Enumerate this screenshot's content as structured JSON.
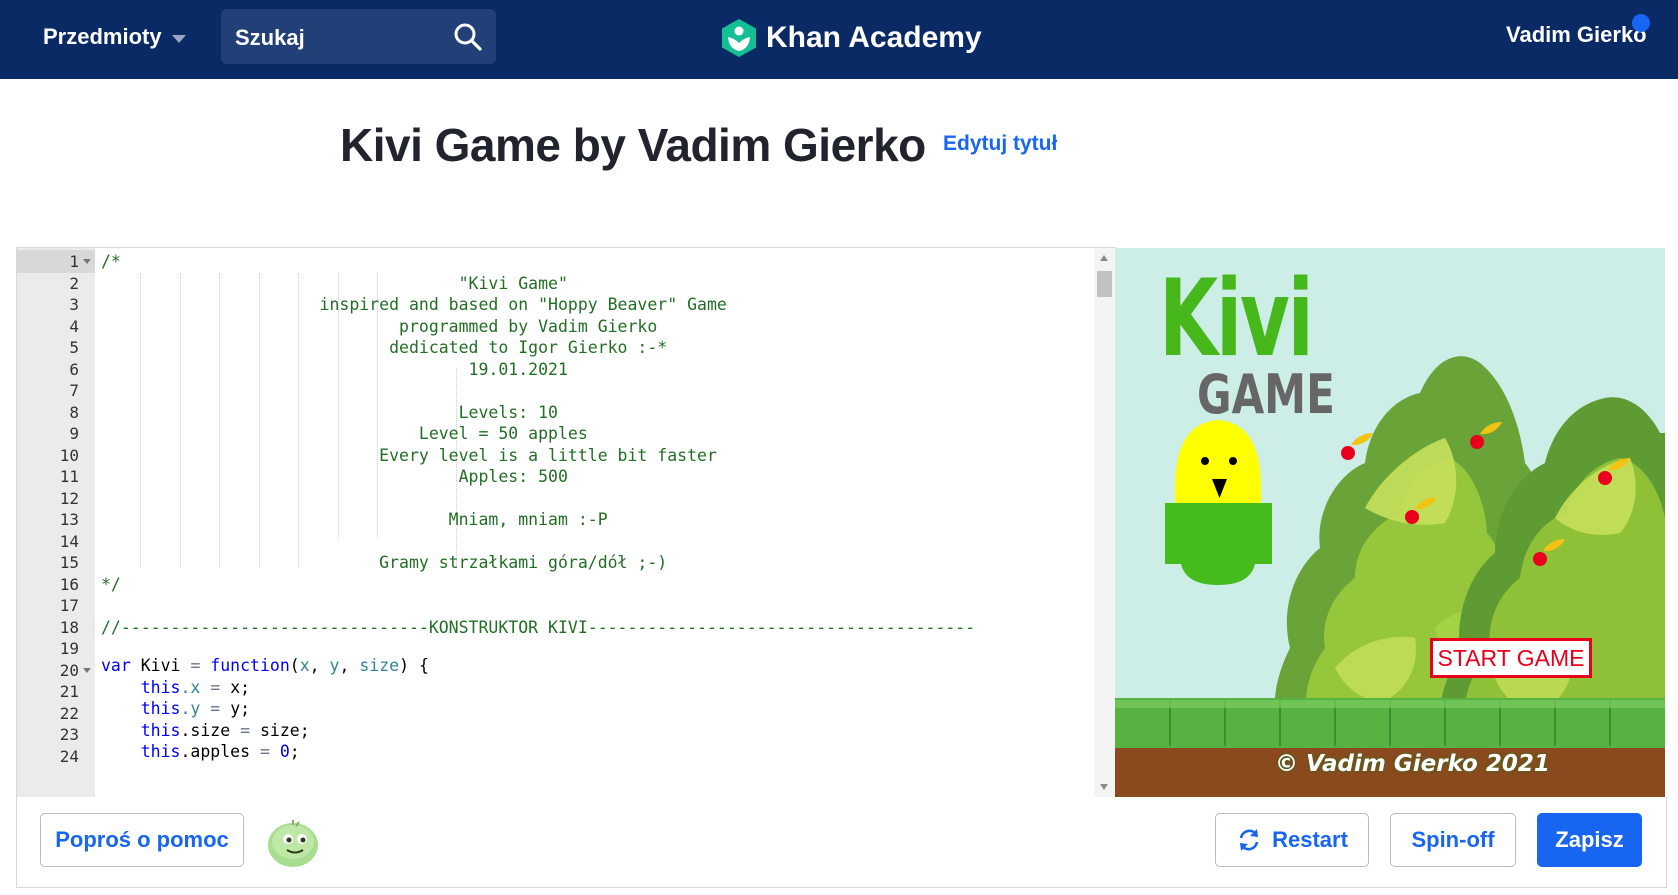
{
  "nav": {
    "subjects_label": "Przedmioty",
    "search_label": "Szukaj",
    "brand_name": "Khan Academy",
    "user_name": "Vadim Gierko",
    "icons": [
      "chevron-down-icon",
      "search-icon",
      "khan-academy-logo-icon",
      "notification-dot-icon"
    ],
    "colors": {
      "nav_bg": "#0a2a66",
      "search_bg": "#223f78",
      "logo_green": "#14bf96",
      "notif": "#1865f2"
    }
  },
  "page": {
    "title": "Kivi Game by Vadim Gierko",
    "edit_title_label": "Edytuj tytuł"
  },
  "editor": {
    "line_numbers": [
      "1",
      "2",
      "3",
      "4",
      "5",
      "6",
      "7",
      "8",
      "9",
      "10",
      "11",
      "12",
      "13",
      "14",
      "15",
      "16",
      "17",
      "18",
      "19",
      "20",
      "21",
      "22",
      "23",
      "24"
    ],
    "fold_lines": [
      1,
      20
    ],
    "comment_lines": [
      "/*",
      "                                    \"Kivi Game\"",
      "                      inspired and based on \"Hoppy Beaver\" Game",
      "                              programmed by Vadim Gierko",
      "                             dedicated to Igor Gierko :-*",
      "                                     19.01.2021",
      "",
      "                                    Levels: 10",
      "                                Level = 50 apples",
      "                            Every level is a little bit faster",
      "                                    Apples: 500",
      "",
      "                                   Mniam, mniam :-P",
      "",
      "                            Gramy strzałkami góra/dół ;-)",
      "*/",
      "",
      "//-------------------------------KONSTRUKTOR KIVI---------------------------------------",
      ""
    ],
    "code_line_20": {
      "kw_var": "var",
      "name": "Kivi",
      "eq": "=",
      "kw_function": "function",
      "params_open": "(",
      "p1": "x",
      "comma1": ", ",
      "p2": "y",
      "comma2": ", ",
      "p3": "size",
      "params_close": ") {"
    },
    "code_line_21": {
      "this": "this",
      "prop": ".x",
      "eq": " = ",
      "val": "x;"
    },
    "code_line_22": {
      "this": "this",
      "prop": ".y",
      "eq": " = ",
      "val": "y;"
    },
    "code_line_23": {
      "this": "this",
      "prop": ".size",
      "eq": " = ",
      "val": "size;"
    },
    "code_line_24": {
      "this": "this",
      "prop": ".apples",
      "eq": " = ",
      "num": "0",
      "semi": ";"
    }
  },
  "preview": {
    "game_title": "Kivi",
    "game_subtitle": "GAME",
    "start_button_label": "START GAME",
    "copyright": "© Vadim Gierko 2021",
    "colors": {
      "sky": "#cdeee6",
      "title_green": "#46b81b",
      "subtitle_gray": "#666666",
      "kivi_yellow": "#ffff00",
      "kivi_body": "#45bb1c",
      "apple_red": "#e8001c",
      "leaf_yellow": "#f3c314",
      "grass": "#56b341",
      "ground": "#8a4a1e",
      "start_red": "#e8001c"
    }
  },
  "actions": {
    "help_label": "Poproś o pomoc",
    "restart_label": "Restart",
    "spinoff_label": "Spin-off",
    "save_label": "Zapisz",
    "icons": [
      "avatar-icon",
      "restart-icon"
    ]
  }
}
